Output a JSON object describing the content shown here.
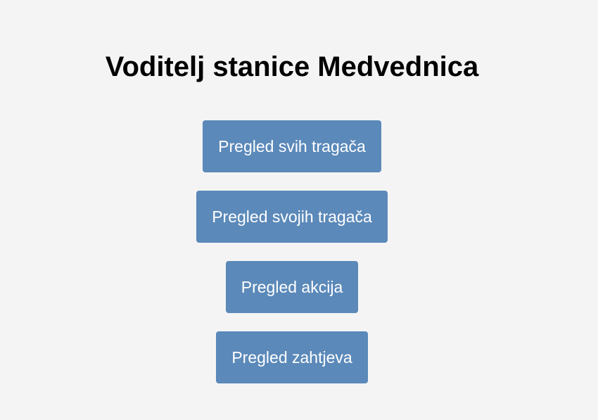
{
  "header": {
    "title": "Voditelj stanice Medvednica"
  },
  "menu": {
    "items": [
      {
        "label": "Pregled svih tragača"
      },
      {
        "label": "Pregled svojih tragača"
      },
      {
        "label": "Pregled akcija"
      },
      {
        "label": "Pregled zahtjeva"
      }
    ]
  },
  "colors": {
    "background": "#f4f4f4",
    "button": "#5b89b9",
    "button_text": "#ffffff",
    "title_text": "#000000"
  }
}
